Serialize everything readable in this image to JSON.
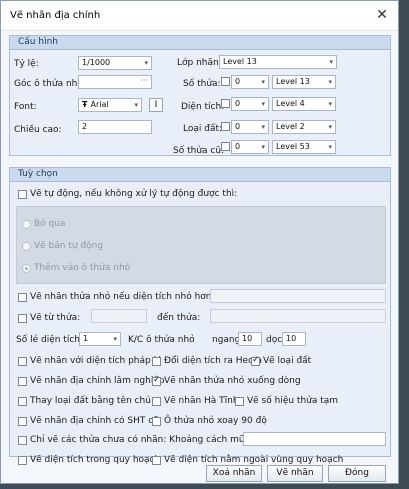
{
  "window": {
    "title": "Vẽ nhãn địa chính",
    "close": "✕"
  },
  "cau_hinh": {
    "header": "Cấu hình",
    "ty_le": {
      "label": "Tỷ lệ:",
      "value": "1/1000"
    },
    "goc": {
      "label": "Góc ô thửa nhỏ",
      "value": "",
      "button": "···"
    },
    "font": {
      "label": "Font:",
      "value": "Arial",
      "italic": "I"
    },
    "chieu_cao": {
      "label": "Chiều cao:",
      "value": "2"
    },
    "lop_nhan": {
      "label": "Lớp nhãn:",
      "value": "Level 13"
    },
    "so_thua": {
      "label": "Số thửa:",
      "num": "0",
      "level": "Level 13"
    },
    "dien_tich": {
      "label": "Diện tích:",
      "num": "0",
      "level": "Level 4"
    },
    "loai_dat": {
      "label": "Loại đất:",
      "num": "0",
      "level": "Level 2"
    },
    "so_thua_cu": {
      "label": "Số thửa cũ:",
      "num": "0",
      "level": "Level 53"
    }
  },
  "tuy_chon": {
    "header": "Tuỳ chọn",
    "auto": {
      "label": "Vẽ tự động, nếu không xử lý tự động được thì:",
      "checked": false
    },
    "radios": [
      {
        "label": "Bỏ qua",
        "selected": false
      },
      {
        "label": "Vẽ bán tự động",
        "selected": false
      },
      {
        "label": "Thêm vào ô thửa nhỏ",
        "selected": true
      }
    ],
    "small": {
      "label": "Vẽ nhãn thửa nhỏ nếu diện tích nhỏ hơn:",
      "value": ""
    },
    "tu_thua": {
      "label": "Vẽ từ thửa:",
      "den": "đến thửa:"
    },
    "so_le": {
      "label": "Số lẻ diện tích:",
      "value": "1",
      "kc": "K/C ô thửa nhỏ",
      "ngang_label": "ngang",
      "ngang": "10",
      "doc_label": "dọc",
      "doc": "10"
    },
    "options": [
      {
        "label": "Vẽ nhãn với diện tích pháp lý",
        "checked": false
      },
      {
        "label": "Đổi diện tích ra Hecta",
        "checked": false
      },
      {
        "label": "Vẽ loại đất",
        "checked": true
      },
      {
        "label": "Vẽ nhãn địa chính lâm nghiệp",
        "checked": false
      },
      {
        "label": "Vẽ nhãn thửa nhỏ xuống dòng",
        "checked": true
      },
      {
        "label": "Thay loại đất bằng tên chủ",
        "checked": false
      },
      {
        "label": "Vẽ nhãn Hà Tĩnh",
        "checked": false
      },
      {
        "label": "Vẽ số hiệu thửa tạm",
        "checked": false
      },
      {
        "label": "Vẽ nhãn địa chính có SHT cũ",
        "checked": false
      },
      {
        "label": "Ô thửa nhỏ xoay 90 độ",
        "checked": false
      },
      {
        "label": "Chỉ vẽ các thửa chưa có nhãn: Khoảng cách mũi tên",
        "checked": false
      },
      {
        "label": "Vẽ diện tích trong quy hoạch",
        "checked": false
      },
      {
        "label": "Vẽ diện tích nằm ngoài vùng quy hoạch",
        "checked": false
      }
    ]
  },
  "buttons": {
    "delete": "Xoá nhãn",
    "draw": "Vẽ nhãn",
    "close": "Đóng"
  }
}
